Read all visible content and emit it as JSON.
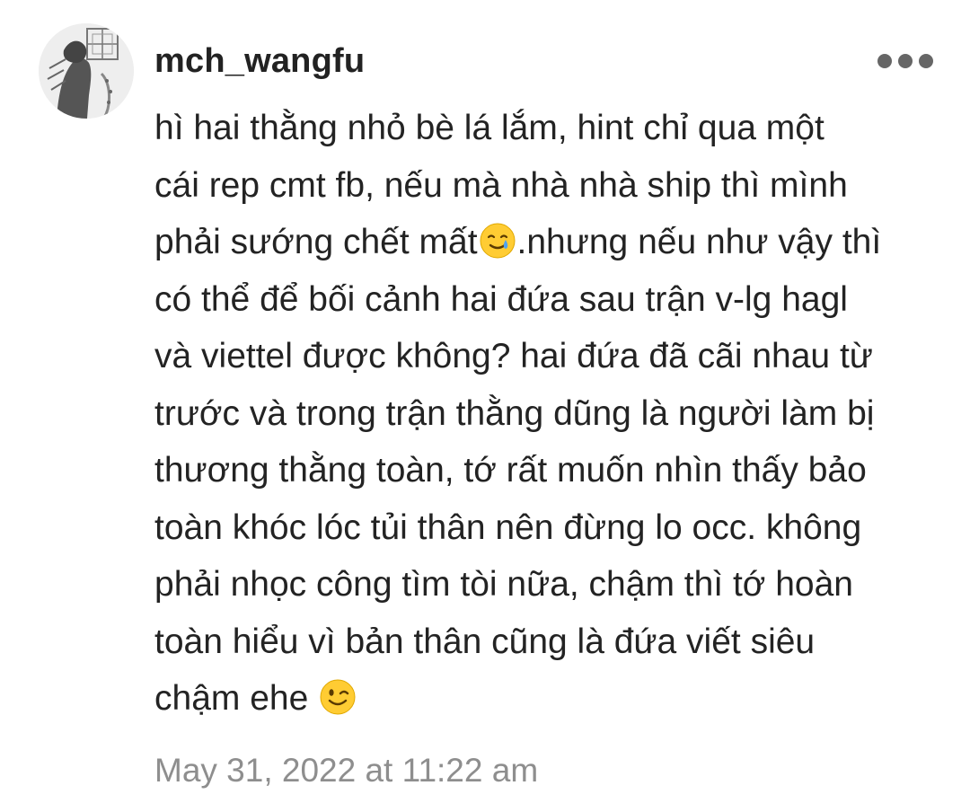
{
  "comment": {
    "username": "mch_wangfu",
    "more_icon": "more-horizontal-icon",
    "lines": [
      {
        "text": "hì hai thằng nhỏ bè lá lắm, hint chỉ qua một"
      },
      {
        "text": "cái rep cmt fb, nếu mà nhà nhà ship thì mình"
      },
      {
        "before": "phải sướng chết mất",
        "emoji": "smiling-face-with-tear-icon",
        "after": ".nhưng nếu như vậy thì"
      },
      {
        "text": "có thể để bối cảnh hai đứa sau trận v-lg hagl"
      },
      {
        "text": "và viettel được không? hai đứa đã cãi nhau từ"
      },
      {
        "text": "trước và trong trận thằng dũng là người làm bị"
      },
      {
        "text": "thương thằng toàn, tớ rất muốn nhìn thấy bảo"
      },
      {
        "text": "toàn khóc lóc tủi thân nên đừng lo occ. không"
      },
      {
        "text": "phải nhọc công tìm tòi nữa, chậm thì tớ hoàn"
      },
      {
        "text": "toàn hiểu vì bản thân cũng là đứa viết siêu"
      },
      {
        "before": "chậm ehe ",
        "emoji": "winking-face-icon",
        "after": ""
      }
    ],
    "timestamp": "May 31, 2022 at 11:22 am"
  },
  "colors": {
    "username": "#222222",
    "text": "#232323",
    "timestamp": "#8e8e8e",
    "more_dots": "#666666",
    "background": "#ffffff",
    "emoji_yellow": "#ffcc33"
  }
}
